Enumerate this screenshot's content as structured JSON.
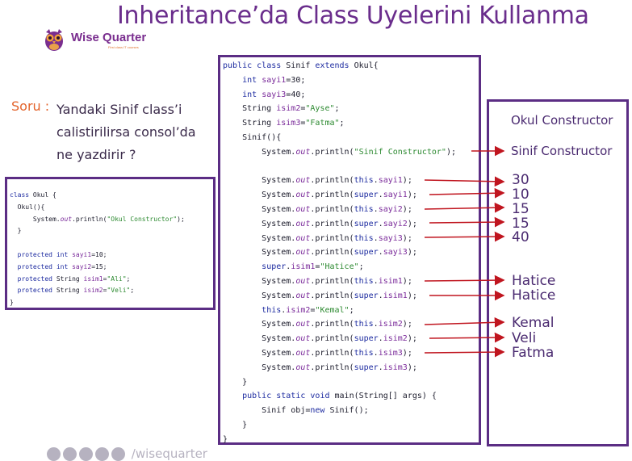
{
  "slide": {
    "title": "Inheritance’da Class Uyelerini Kullanma"
  },
  "logo": {
    "name": "Wise Quarter",
    "tagline": "First class IT courses"
  },
  "question": {
    "label": "Soru :",
    "lines": [
      "Yandaki Sinif class’i",
      "calistirilirsa consol’da",
      "ne yazdirir ?"
    ]
  },
  "okul_code": [
    "class Okul {",
    "  Okul(){",
    "      System.out.println(\"Okul Constructor\");",
    "  }",
    "",
    "  protected int sayi1=10;",
    "  protected int sayi2=15;",
    "  protected String isim1=\"Ali\";",
    "  protected String isim2=\"Veli\";",
    "}"
  ],
  "sinif_code": [
    "public class Sinif extends Okul{",
    "    int sayi1=30;",
    "    int sayi3=40;",
    "    String isim2=\"Ayse\";",
    "    String isim3=\"Fatma\";",
    "    Sinif(){",
    "        System.out.println(\"Sinif Constructor\");",
    "",
    "        System.out.println(this.sayi1);",
    "        System.out.println(super.sayi1);",
    "        System.out.println(this.sayi2);",
    "        System.out.println(super.sayi2);",
    "        System.out.println(this.sayi3);",
    "        System.out.println(super.sayi3);",
    "        super.isim1=\"Hatice\";",
    "        System.out.println(this.isim1);",
    "        System.out.println(super.isim1);",
    "        this.isim2=\"Kemal\";",
    "        System.out.println(this.isim2);",
    "        System.out.println(super.isim2);",
    "        System.out.println(this.isim3);",
    "        System.out.println(super.isim3);",
    "    }",
    "    public static void main(String[] args) {",
    "        Sinif obj=new Sinif();",
    "    }",
    "}"
  ],
  "output": [
    "Okul Constructor",
    "Sinif Constructor",
    "30",
    "10",
    "15",
    "15",
    "40",
    "Hatice",
    "Hatice",
    "Kemal",
    "Veli",
    "Fatma"
  ],
  "footer": {
    "handle": "/wisequarter"
  },
  "colors": {
    "title": "#6a2d8c",
    "border": "#5b2d84",
    "arrow": "#c0151f",
    "label": "#e3642c"
  }
}
